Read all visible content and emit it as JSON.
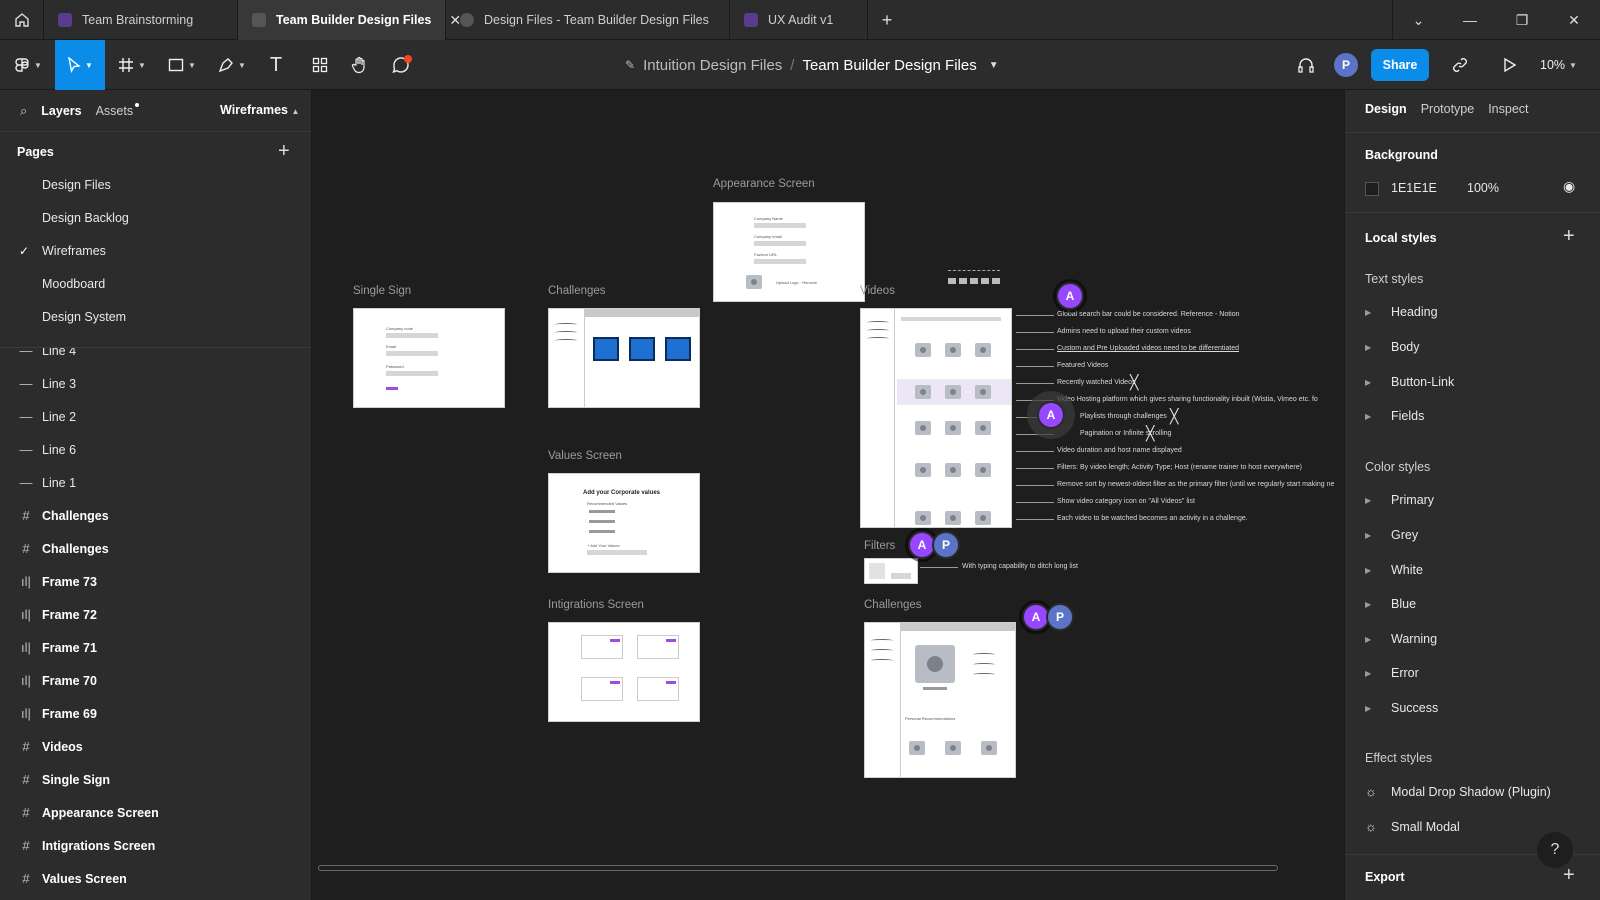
{
  "tabs": [
    {
      "label": "Team Brainstorming",
      "icon": "figjam-icon"
    },
    {
      "label": "Team Builder Design Files",
      "icon": "figma-file-icon"
    },
    {
      "label": "Design Files - Team Builder Design Files",
      "icon": "play-icon"
    },
    {
      "label": "UX Audit v1",
      "icon": "figjam-icon"
    }
  ],
  "toolbar": {
    "breadcrumb_project": "Intuition Design Files",
    "breadcrumb_sep": "/",
    "file_name": "Team Builder Design Files",
    "share_label": "Share",
    "zoom": "10%",
    "user_avatar": "P"
  },
  "left_panel": {
    "layers_tab": "Layers",
    "assets_tab": "Assets",
    "current_page": "Wireframes",
    "pages_title": "Pages",
    "pages": [
      "Design Files",
      "Design Backlog",
      "Wireframes",
      "Moodboard",
      "Design System"
    ],
    "layers": [
      {
        "name": "Line 4",
        "icon": "line"
      },
      {
        "name": "Line 3",
        "icon": "line"
      },
      {
        "name": "Line 2",
        "icon": "line"
      },
      {
        "name": "Line 6",
        "icon": "line"
      },
      {
        "name": "Line 1",
        "icon": "line"
      },
      {
        "name": "Challenges",
        "icon": "frame"
      },
      {
        "name": "Challenges",
        "icon": "frame"
      },
      {
        "name": "Frame 73",
        "icon": "autolayout"
      },
      {
        "name": "Frame 72",
        "icon": "autolayout"
      },
      {
        "name": "Frame 71",
        "icon": "autolayout"
      },
      {
        "name": "Frame 70",
        "icon": "autolayout"
      },
      {
        "name": "Frame 69",
        "icon": "autolayout"
      },
      {
        "name": "Videos",
        "icon": "frame"
      },
      {
        "name": "Single Sign",
        "icon": "frame"
      },
      {
        "name": "Appearance Screen",
        "icon": "frame"
      },
      {
        "name": "Intigrations Screen",
        "icon": "frame"
      },
      {
        "name": "Values Screen",
        "icon": "frame"
      }
    ]
  },
  "canvas": {
    "frames": {
      "appearance": "Appearance Screen",
      "single_sign": "Single Sign",
      "challenges1": "Challenges",
      "videos": "Videos",
      "values": "Values Screen",
      "filters": "Filters",
      "integrations": "Intigrations Screen",
      "challenges2": "Challenges"
    },
    "wire_text": {
      "company_name": "Company Name",
      "company_email": "Company email",
      "favicon": "Favicon URL",
      "upload_logo": "Upload Logo · Remove",
      "company_code": "Company code",
      "email": "Email",
      "password": "Password",
      "values_title": "Add your Corporate values",
      "recommended": "Recommended Values",
      "add_values": "+ Add Your Values",
      "recommendations": "Personal Recommendations"
    },
    "annotations": [
      "Global search bar could be considered. Reference - Notion",
      "Admins need to upload their custom videos",
      "Custom and Pre Uploaded videos need to be differentiated",
      "Featured Videos",
      "Recently watched Videos",
      "Video Hosting platform which gives sharing functionality inbuilt (Wistia, Vimeo etc. fo",
      "Playlists through challenges",
      "Pagination or Infinite scrolling",
      "Video duration and host name displayed",
      "Filters: By video length; Activity Type; Host (rename trainer to host everywhere)",
      "Remove sort by newest-oldest filter as the primary filter (until we regularly start making ne",
      "Show video category icon on \"All Videos\" list",
      "Each video to be watched becomes an activity in a challenge."
    ],
    "filters_note": "With typing capability to ditch long list",
    "cursors": [
      "A",
      "A",
      "A",
      "P",
      "A",
      "P"
    ]
  },
  "right_panel": {
    "tabs": [
      "Design",
      "Prototype",
      "Inspect"
    ],
    "background_title": "Background",
    "bg_hex": "1E1E1E",
    "bg_opacity": "100%",
    "local_styles_title": "Local styles",
    "text_styles_title": "Text styles",
    "text_styles": [
      "Heading",
      "Body",
      "Button-Link",
      "Fields"
    ],
    "color_styles_title": "Color styles",
    "color_styles": [
      "Primary",
      "Grey",
      "White",
      "Blue",
      "Warning",
      "Error",
      "Success"
    ],
    "effect_styles_title": "Effect styles",
    "effect_styles": [
      "Modal Drop Shadow (Plugin)",
      "Small Modal"
    ],
    "export_title": "Export",
    "help": "?"
  },
  "colors": {
    "accent": "#0C8CE9",
    "cursor_purple": "#9747FF",
    "panel": "#2C2C2C",
    "canvas": "#1E1E1E"
  }
}
